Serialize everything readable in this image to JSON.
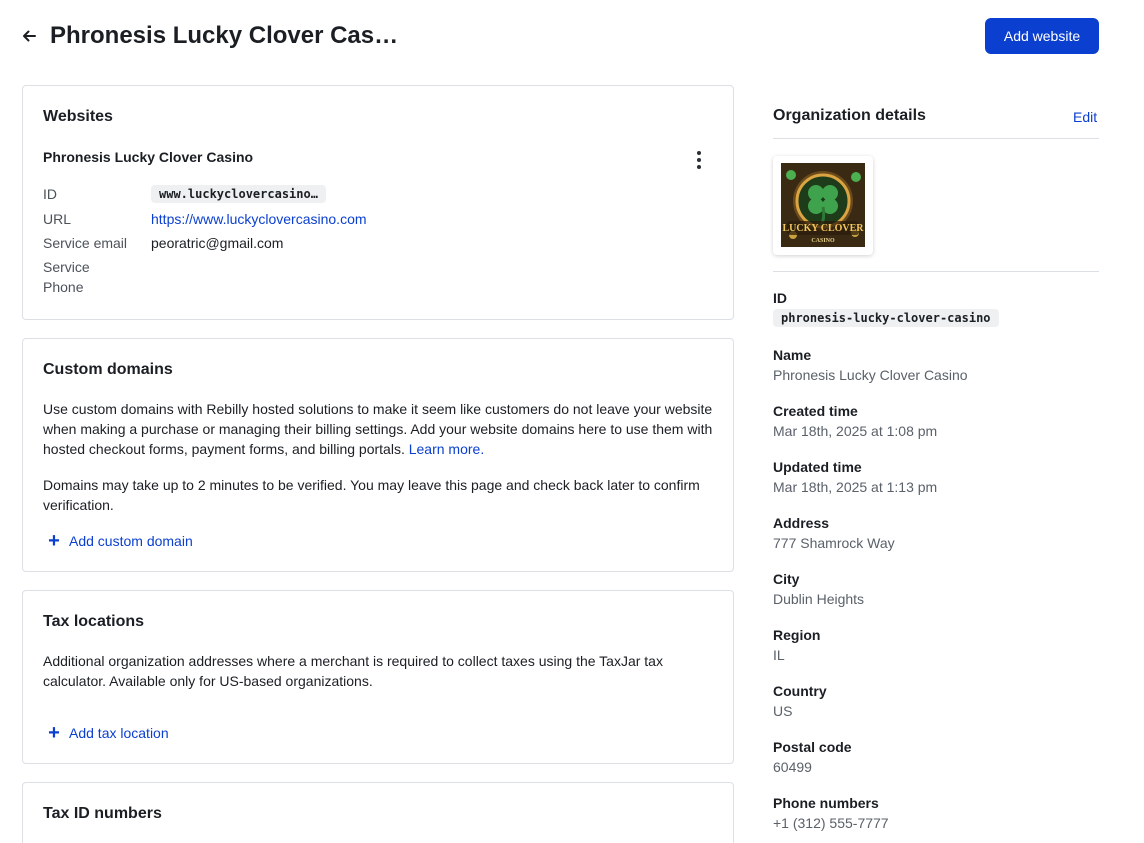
{
  "header": {
    "title": "Phronesis Lucky Clover Cas…",
    "back_icon": "arrow-left-icon",
    "add_website_label": "Add website"
  },
  "websites": {
    "title": "Websites",
    "site_name": "Phronesis Lucky Clover Casino",
    "menu_icon": "kebab-vertical-icon",
    "fields": {
      "id_label": "ID",
      "id_value": "www.luckyclovercasino…",
      "url_label": "URL",
      "url_value": "https://www.luckyclovercasino.com",
      "email_label": "Service email",
      "email_value": "peoratric@gmail.com",
      "phone_label_line1": "Service",
      "phone_label_line2": "Phone"
    }
  },
  "custom_domains": {
    "title": "Custom domains",
    "description": "Use custom domains with Rebilly hosted solutions to make it seem like customers do not leave your website when making a purchase or managing their billing settings. Add your website domains here to use them with hosted checkout forms, payment forms, and billing portals.",
    "learn_more": "Learn more.",
    "note": "Domains may take up to 2 minutes to be verified. You may leave this page and check back later to confirm verification.",
    "add_label": "Add custom domain"
  },
  "tax_locations": {
    "title": "Tax locations",
    "description": "Additional organization addresses where a merchant is required to collect taxes using the TaxJar tax calculator. Available only for US-based organizations.",
    "add_label": "Add tax location"
  },
  "tax_ids": {
    "title": "Tax ID numbers"
  },
  "organization": {
    "title": "Organization details",
    "edit_label": "Edit",
    "logo": {
      "text_main": "LUCKY CLOVER",
      "text_sub": "CASINO",
      "icon": "clover-icon"
    },
    "id_label": "ID",
    "id_value": "phronesis-lucky-clover-casino",
    "name_label": "Name",
    "name_value": "Phronesis Lucky Clover Casino",
    "created_label": "Created time",
    "created_value": "Mar 18th, 2025 at 1:08 pm",
    "updated_label": "Updated time",
    "updated_value": "Mar 18th, 2025 at 1:13 pm",
    "address_label": "Address",
    "address_value": "777 Shamrock Way",
    "city_label": "City",
    "city_value": "Dublin Heights",
    "region_label": "Region",
    "region_value": "IL",
    "country_label": "Country",
    "country_value": "US",
    "postal_label": "Postal code",
    "postal_value": "60499",
    "phone_label": "Phone numbers",
    "phone_value": "+1 (312) 555-7777"
  },
  "colors": {
    "accent": "#0b3fcf",
    "border": "#dcdfe3",
    "muted_text": "#5a6169"
  }
}
